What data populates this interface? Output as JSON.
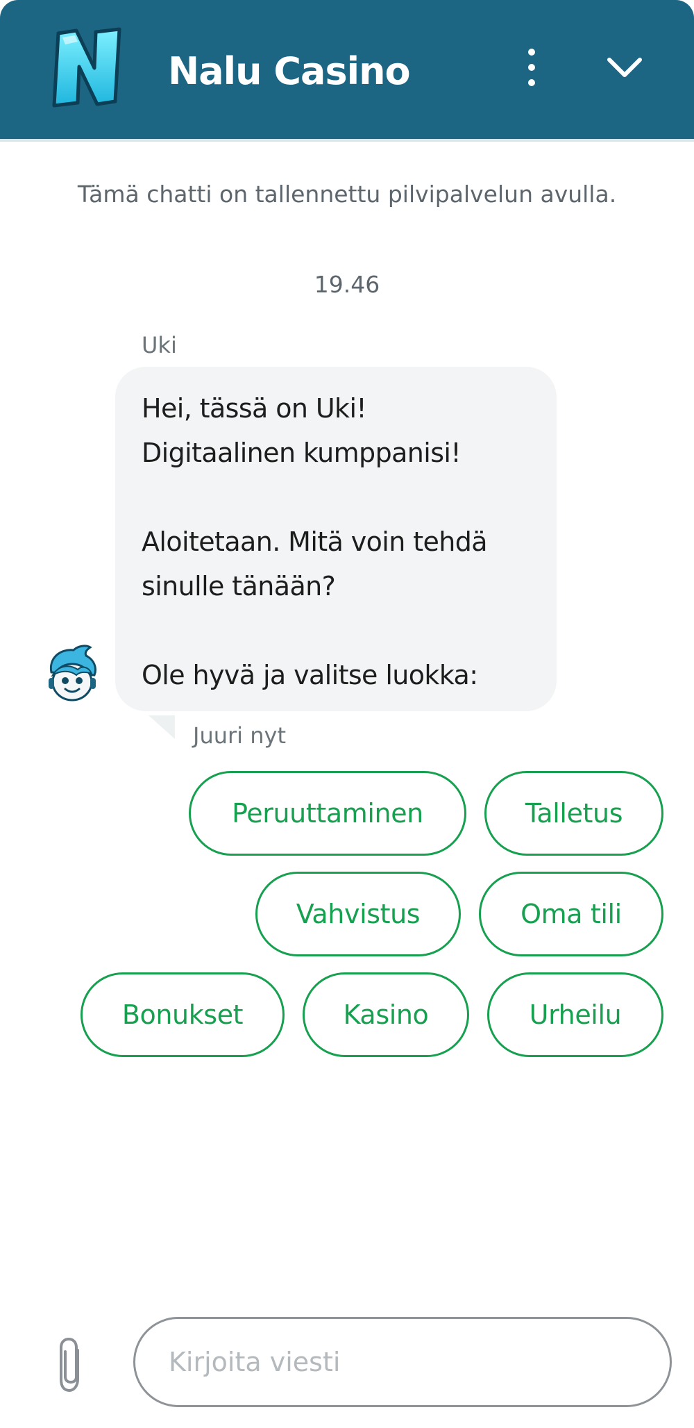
{
  "colors": {
    "header_bg": "#1c6684",
    "accent": "#17a050",
    "bubble_bg": "#f2f4f5"
  },
  "header": {
    "logo_icon": "nalu-n-logo-icon",
    "title": "Nalu Casino",
    "menu_icon": "kebab-menu-icon",
    "minimize_icon": "chevron-down-icon"
  },
  "chat": {
    "notice": "Tämä chatti on tallennettu pilvipalvelun avulla.",
    "timestamp": "19.46",
    "message": {
      "sender": "Uki",
      "avatar_icon": "uki-avatar-icon",
      "lines": [
        "Hei, tässä on Uki!",
        "Digitaalinen kumppanisi!",
        "",
        "Aloitetaan. Mitä voin tehdä",
        "sinulle tänään?",
        "",
        "Ole hyvä ja valitse luokka:"
      ],
      "time": "Juuri nyt"
    },
    "quick_replies": [
      "Peruuttaminen",
      "Talletus",
      "Vahvistus",
      "Oma tili",
      "Bonukset",
      "Kasino",
      "Urheilu"
    ]
  },
  "composer": {
    "attach_icon": "paperclip-icon",
    "placeholder": "Kirjoita viesti",
    "value": ""
  }
}
